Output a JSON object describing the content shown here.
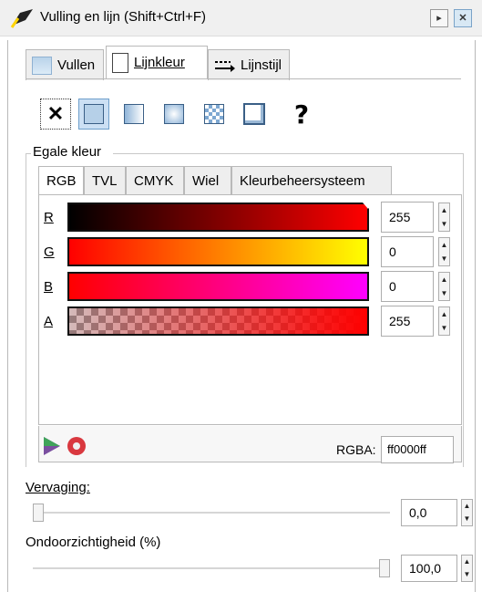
{
  "window": {
    "title": "Vulling en lijn (Shift+Ctrl+F)"
  },
  "tabs": [
    "Vullen",
    "Lijnkleur",
    "Lijnstijl"
  ],
  "fill_modes": {
    "help_label": "?"
  },
  "group_label": "Egale kleur",
  "color_tabs": [
    "RGB",
    "TVL",
    "CMYK",
    "Wiel",
    "Kleurbeheersysteem"
  ],
  "channels": [
    {
      "label": "R",
      "value": "255",
      "gradient_from": "#000000",
      "gradient_to": "#ff0000"
    },
    {
      "label": "G",
      "value": "0",
      "gradient_from": "#ff0000",
      "gradient_to": "#ffff00"
    },
    {
      "label": "B",
      "value": "0",
      "gradient_from": "#ff0000",
      "gradient_to": "#ff00ff"
    },
    {
      "label": "A",
      "value": "255",
      "gradient_from": "#ff0000",
      "gradient_to": "#ff0000"
    }
  ],
  "rgba": {
    "label": "RGBA:",
    "value": "ff0000ff"
  },
  "blur": {
    "label": "Vervaging:",
    "value": "0,0",
    "level_percent": 0
  },
  "opacity": {
    "label": "Ondoorzichtigheid (%)",
    "value": "100,0",
    "level_percent": 100
  },
  "colors": {
    "accent": "#cce0f4",
    "current_color": "#ff0000"
  }
}
